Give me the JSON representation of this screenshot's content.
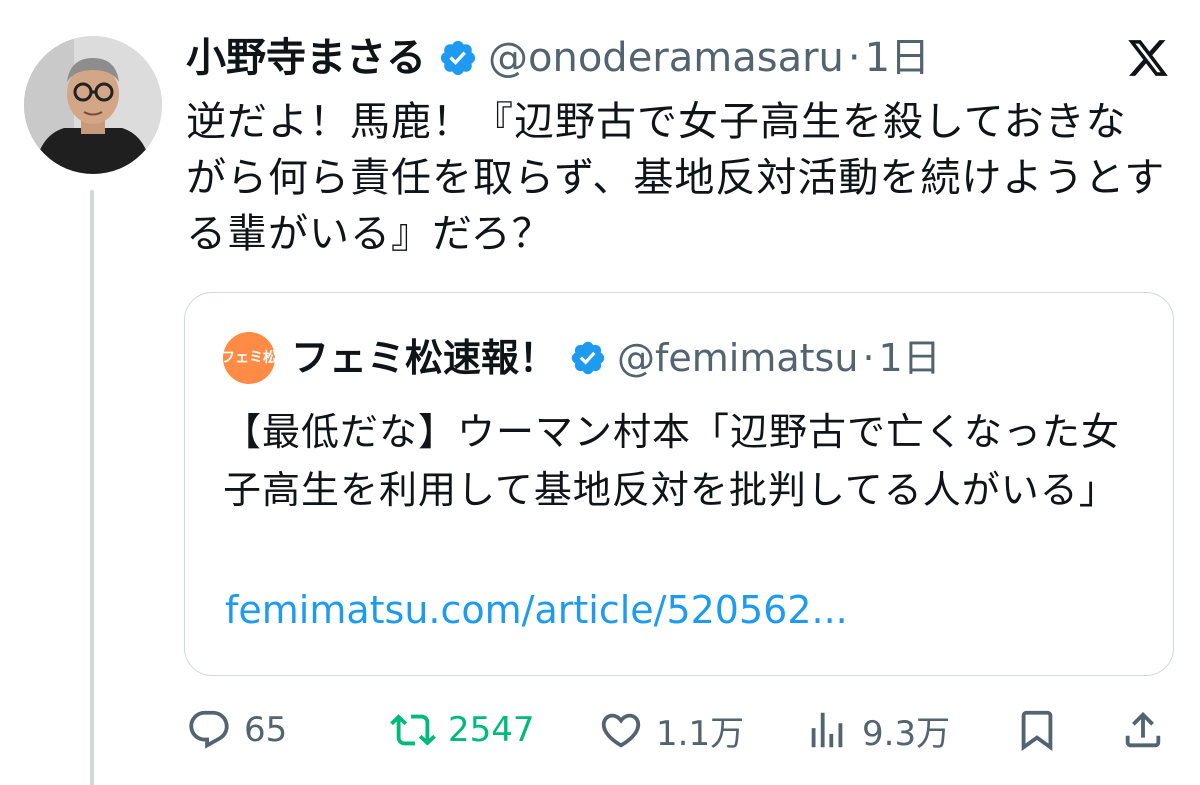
{
  "author": {
    "display_name": "小野寺まさる",
    "handle": "@onoderamasaru",
    "separator": "·",
    "time": "1日",
    "verified_color": "#1d9bf0"
  },
  "tweet": {
    "text": "逆だよ！馬鹿！『辺野古で女子高生を殺しておきながら何ら責任を取らず、基地反対活動を続けようとする輩がいる』だろ？"
  },
  "quote": {
    "avatar_label": "フェミ松",
    "avatar_color": "#ff8b45",
    "display_name": "フェミ松速報！",
    "handle": "@femimatsu",
    "separator": "·",
    "time": "1日",
    "text": "【最低だな】ウーマン村本「辺野古で亡くなった女子高生を利用して基地反対を批判してる人がいる」",
    "link": "femimatsu.com/article/520562...",
    "link_color": "#1d9bf0"
  },
  "actions": {
    "replies": "65",
    "retweets": "2547",
    "retweet_color": "#00ba7c",
    "likes": "1.1万",
    "views": "9.3万"
  },
  "icons": [
    "x-logo-icon",
    "verified-badge-icon",
    "reply-icon",
    "retweet-icon",
    "like-icon",
    "views-icon",
    "bookmark-icon",
    "share-icon"
  ]
}
